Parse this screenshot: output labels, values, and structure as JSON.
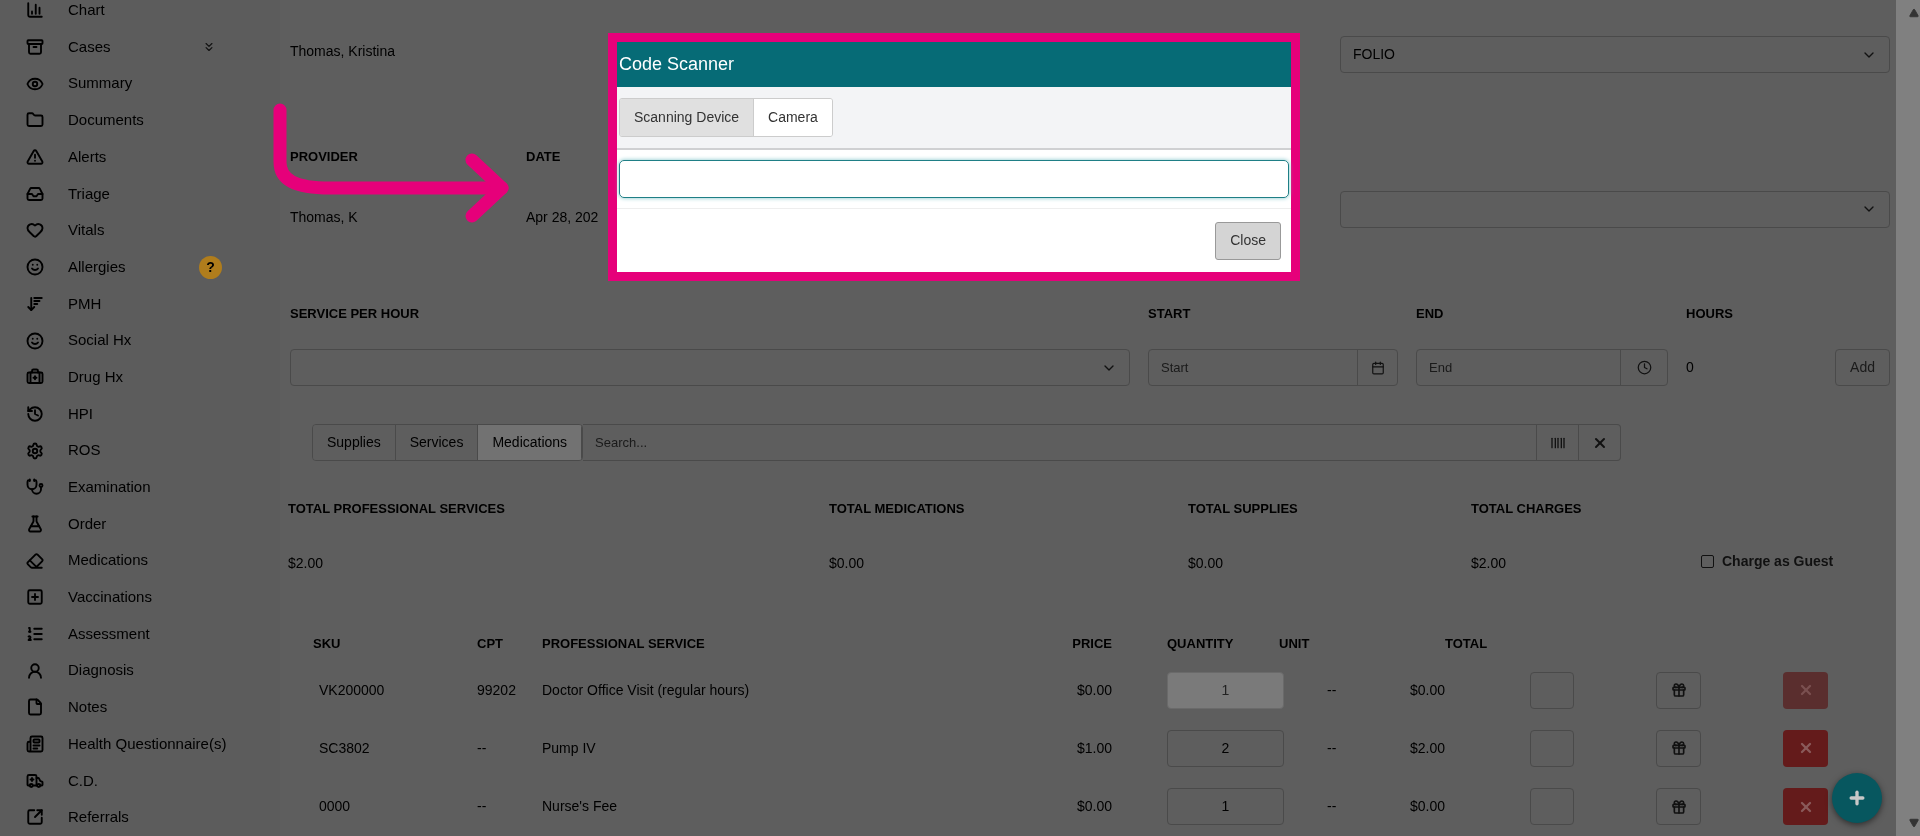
{
  "sidebar": {
    "items": [
      {
        "label": "Chart",
        "expandable": false
      },
      {
        "label": "Cases",
        "expandable": true
      },
      {
        "label": "Summary",
        "expandable": false
      },
      {
        "label": "Documents",
        "expandable": false
      },
      {
        "label": "Alerts",
        "expandable": false
      },
      {
        "label": "Triage",
        "expandable": false
      },
      {
        "label": "Vitals",
        "expandable": false
      },
      {
        "label": "Allergies",
        "expandable": false,
        "badge": "?"
      },
      {
        "label": "PMH",
        "expandable": false
      },
      {
        "label": "Social Hx",
        "expandable": false
      },
      {
        "label": "Drug Hx",
        "expandable": false
      },
      {
        "label": "HPI",
        "expandable": false
      },
      {
        "label": "ROS",
        "expandable": false
      },
      {
        "label": "Examination",
        "expandable": false
      },
      {
        "label": "Order",
        "expandable": false
      },
      {
        "label": "Medications",
        "expandable": false
      },
      {
        "label": "Vaccinations",
        "expandable": false
      },
      {
        "label": "Assessment",
        "expandable": false
      },
      {
        "label": "Diagnosis",
        "expandable": false
      },
      {
        "label": "Notes",
        "expandable": false
      },
      {
        "label": "Health Questionnaire(s)",
        "expandable": false
      },
      {
        "label": "C.D.",
        "expandable": false
      },
      {
        "label": "Referrals",
        "expandable": false
      }
    ]
  },
  "case": {
    "created_by": "Thomas, Kristina",
    "settlement_type": "FOLIO",
    "provider_label": "PROVIDER",
    "provider": "Thomas, K",
    "date_label": "DATE",
    "date": "Apr 28, 202"
  },
  "service_per_hour": {
    "label": "SERVICE PER HOUR",
    "start_label": "START",
    "start_placeholder": "Start",
    "end_label": "END",
    "end_placeholder": "End",
    "hours_label": "HOURS",
    "hours": "0",
    "add": "Add"
  },
  "catalog": {
    "tabs": [
      {
        "label": "Supplies",
        "selected": false
      },
      {
        "label": "Services",
        "selected": false
      },
      {
        "label": "Medications",
        "selected": true
      }
    ],
    "search_placeholder": "Search..."
  },
  "totals": [
    {
      "label": "TOTAL PROFESSIONAL SERVICES",
      "value": "$2.00"
    },
    {
      "label": "TOTAL MEDICATIONS",
      "value": "$0.00"
    },
    {
      "label": "TOTAL SUPPLIES",
      "value": "$0.00"
    },
    {
      "label": "TOTAL CHARGES",
      "value": "$2.00"
    }
  ],
  "charge_as_guest": {
    "label": "Charge as Guest",
    "checked": false
  },
  "table": {
    "columns": [
      "SKU",
      "CPT",
      "PROFESSIONAL SERVICE",
      "PRICE",
      "QUANTITY",
      "UNIT",
      "TOTAL"
    ],
    "rows": [
      {
        "sku": "VK200000",
        "cpt": "99202",
        "service": "Doctor Office Visit (regular hours)",
        "price": "$0.00",
        "quantity": "1",
        "unit": "--",
        "total": "$0.00",
        "disabled": true
      },
      {
        "sku": "SC3802",
        "cpt": "--",
        "service": "Pump IV",
        "price": "$1.00",
        "quantity": "2",
        "unit": "--",
        "total": "$2.00",
        "disabled": false
      },
      {
        "sku": "0000",
        "cpt": "--",
        "service": "Nurse's Fee",
        "price": "$0.00",
        "quantity": "1",
        "unit": "--",
        "total": "$0.00",
        "disabled": false
      }
    ]
  },
  "modal": {
    "title": "Code Scanner",
    "tabs": [
      {
        "label": "Scanning Device",
        "selected": true
      },
      {
        "label": "Camera",
        "selected": false
      }
    ],
    "close": "Close"
  }
}
